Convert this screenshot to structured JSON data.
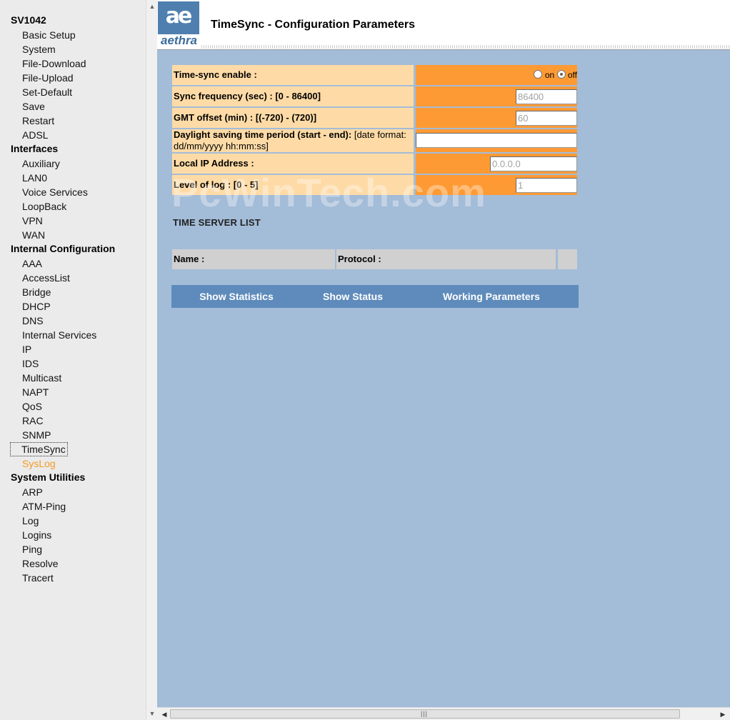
{
  "nav": {
    "title": "SV1042",
    "basic": [
      "Basic Setup",
      "System",
      "File-Download",
      "File-Upload",
      "Set-Default",
      "Save",
      "Restart",
      "ADSL"
    ],
    "interfaces_title": "Interfaces",
    "interfaces": [
      "Auxiliary",
      "LAN0",
      "Voice Services",
      "LoopBack",
      "VPN",
      "WAN"
    ],
    "internal_title": "Internal Configuration",
    "internal": [
      "AAA",
      "AccessList",
      "Bridge",
      "DHCP",
      "DNS",
      "Internal Services",
      "IP",
      "IDS",
      "Multicast",
      "NAPT",
      "QoS",
      "RAC",
      "SNMP",
      "TimeSync",
      "SysLog"
    ],
    "utilities_title": "System Utilities",
    "utilities": [
      "ARP",
      "ATM-Ping",
      "Log",
      "Logins",
      "Ping",
      "Resolve",
      "Tracert"
    ]
  },
  "header": {
    "logo_mark": "ae",
    "logo_word": "aethra",
    "title": "TimeSync - Configuration Parameters"
  },
  "form": {
    "timesync_label": "Time-sync enable :",
    "radio_on": "on",
    "radio_off": "off",
    "radio_selected": "off",
    "sync_label": "Sync frequency (sec) : [0 - 86400]",
    "sync_value": "86400",
    "gmt_label": "GMT offset (min) : [(-720) - (720)]",
    "gmt_value": "60",
    "dst_label_bold": "Daylight saving time period (start - end):",
    "dst_label_hint": "[date format: dd/mm/yyyy hh:mm:ss]",
    "dst_value": "",
    "local_ip_label": "Local IP Address :",
    "local_ip_value": "0.0.0.0",
    "log_label": "Level of log : [0 - 5]",
    "log_value": "1"
  },
  "server_list": {
    "heading": "TIME SERVER LIST",
    "col_name": "Name :",
    "col_protocol": "Protocol :"
  },
  "tabs": {
    "statistics": "Show Statistics",
    "status": "Show Status",
    "working": "Working Parameters"
  },
  "watermark": "PcWinTech.com",
  "colors": {
    "label_bg": "#fedba6",
    "value_bg": "#fe9a34",
    "content_bg": "#a3bcd8",
    "tab_bg": "#5e8bbb",
    "nav_hover": "#f39b24"
  }
}
